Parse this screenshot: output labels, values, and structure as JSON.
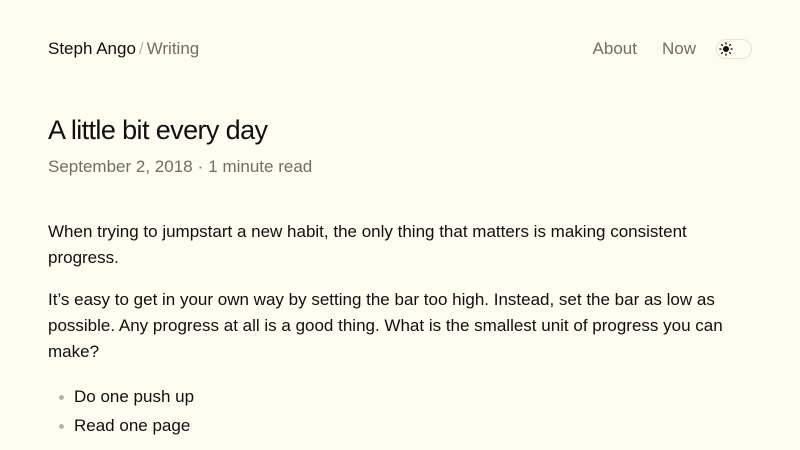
{
  "header": {
    "site_name": "Steph Ango",
    "separator": "/",
    "section": "Writing",
    "nav": {
      "about": "About",
      "now": "Now"
    },
    "theme_toggle_icon": "sun-icon"
  },
  "article": {
    "title": "A little bit every day",
    "date": "September 2, 2018",
    "meta_separator": "·",
    "read_time": "1 minute read",
    "paragraphs": [
      "When trying to jumpstart a new habit, the only thing that matters is making consistent progress.",
      "It’s easy to get in your own way by setting the bar too high. Instead, set the bar as low as possible. Any progress at all is a good thing. What is the smallest unit of progress you can make?"
    ],
    "list_items": [
      "Do one push up",
      "Read one page"
    ]
  },
  "colors": {
    "background": "#fffcf0",
    "text": "#100f0f",
    "muted": "#6f6e69",
    "bullet": "#b7b5ac"
  }
}
